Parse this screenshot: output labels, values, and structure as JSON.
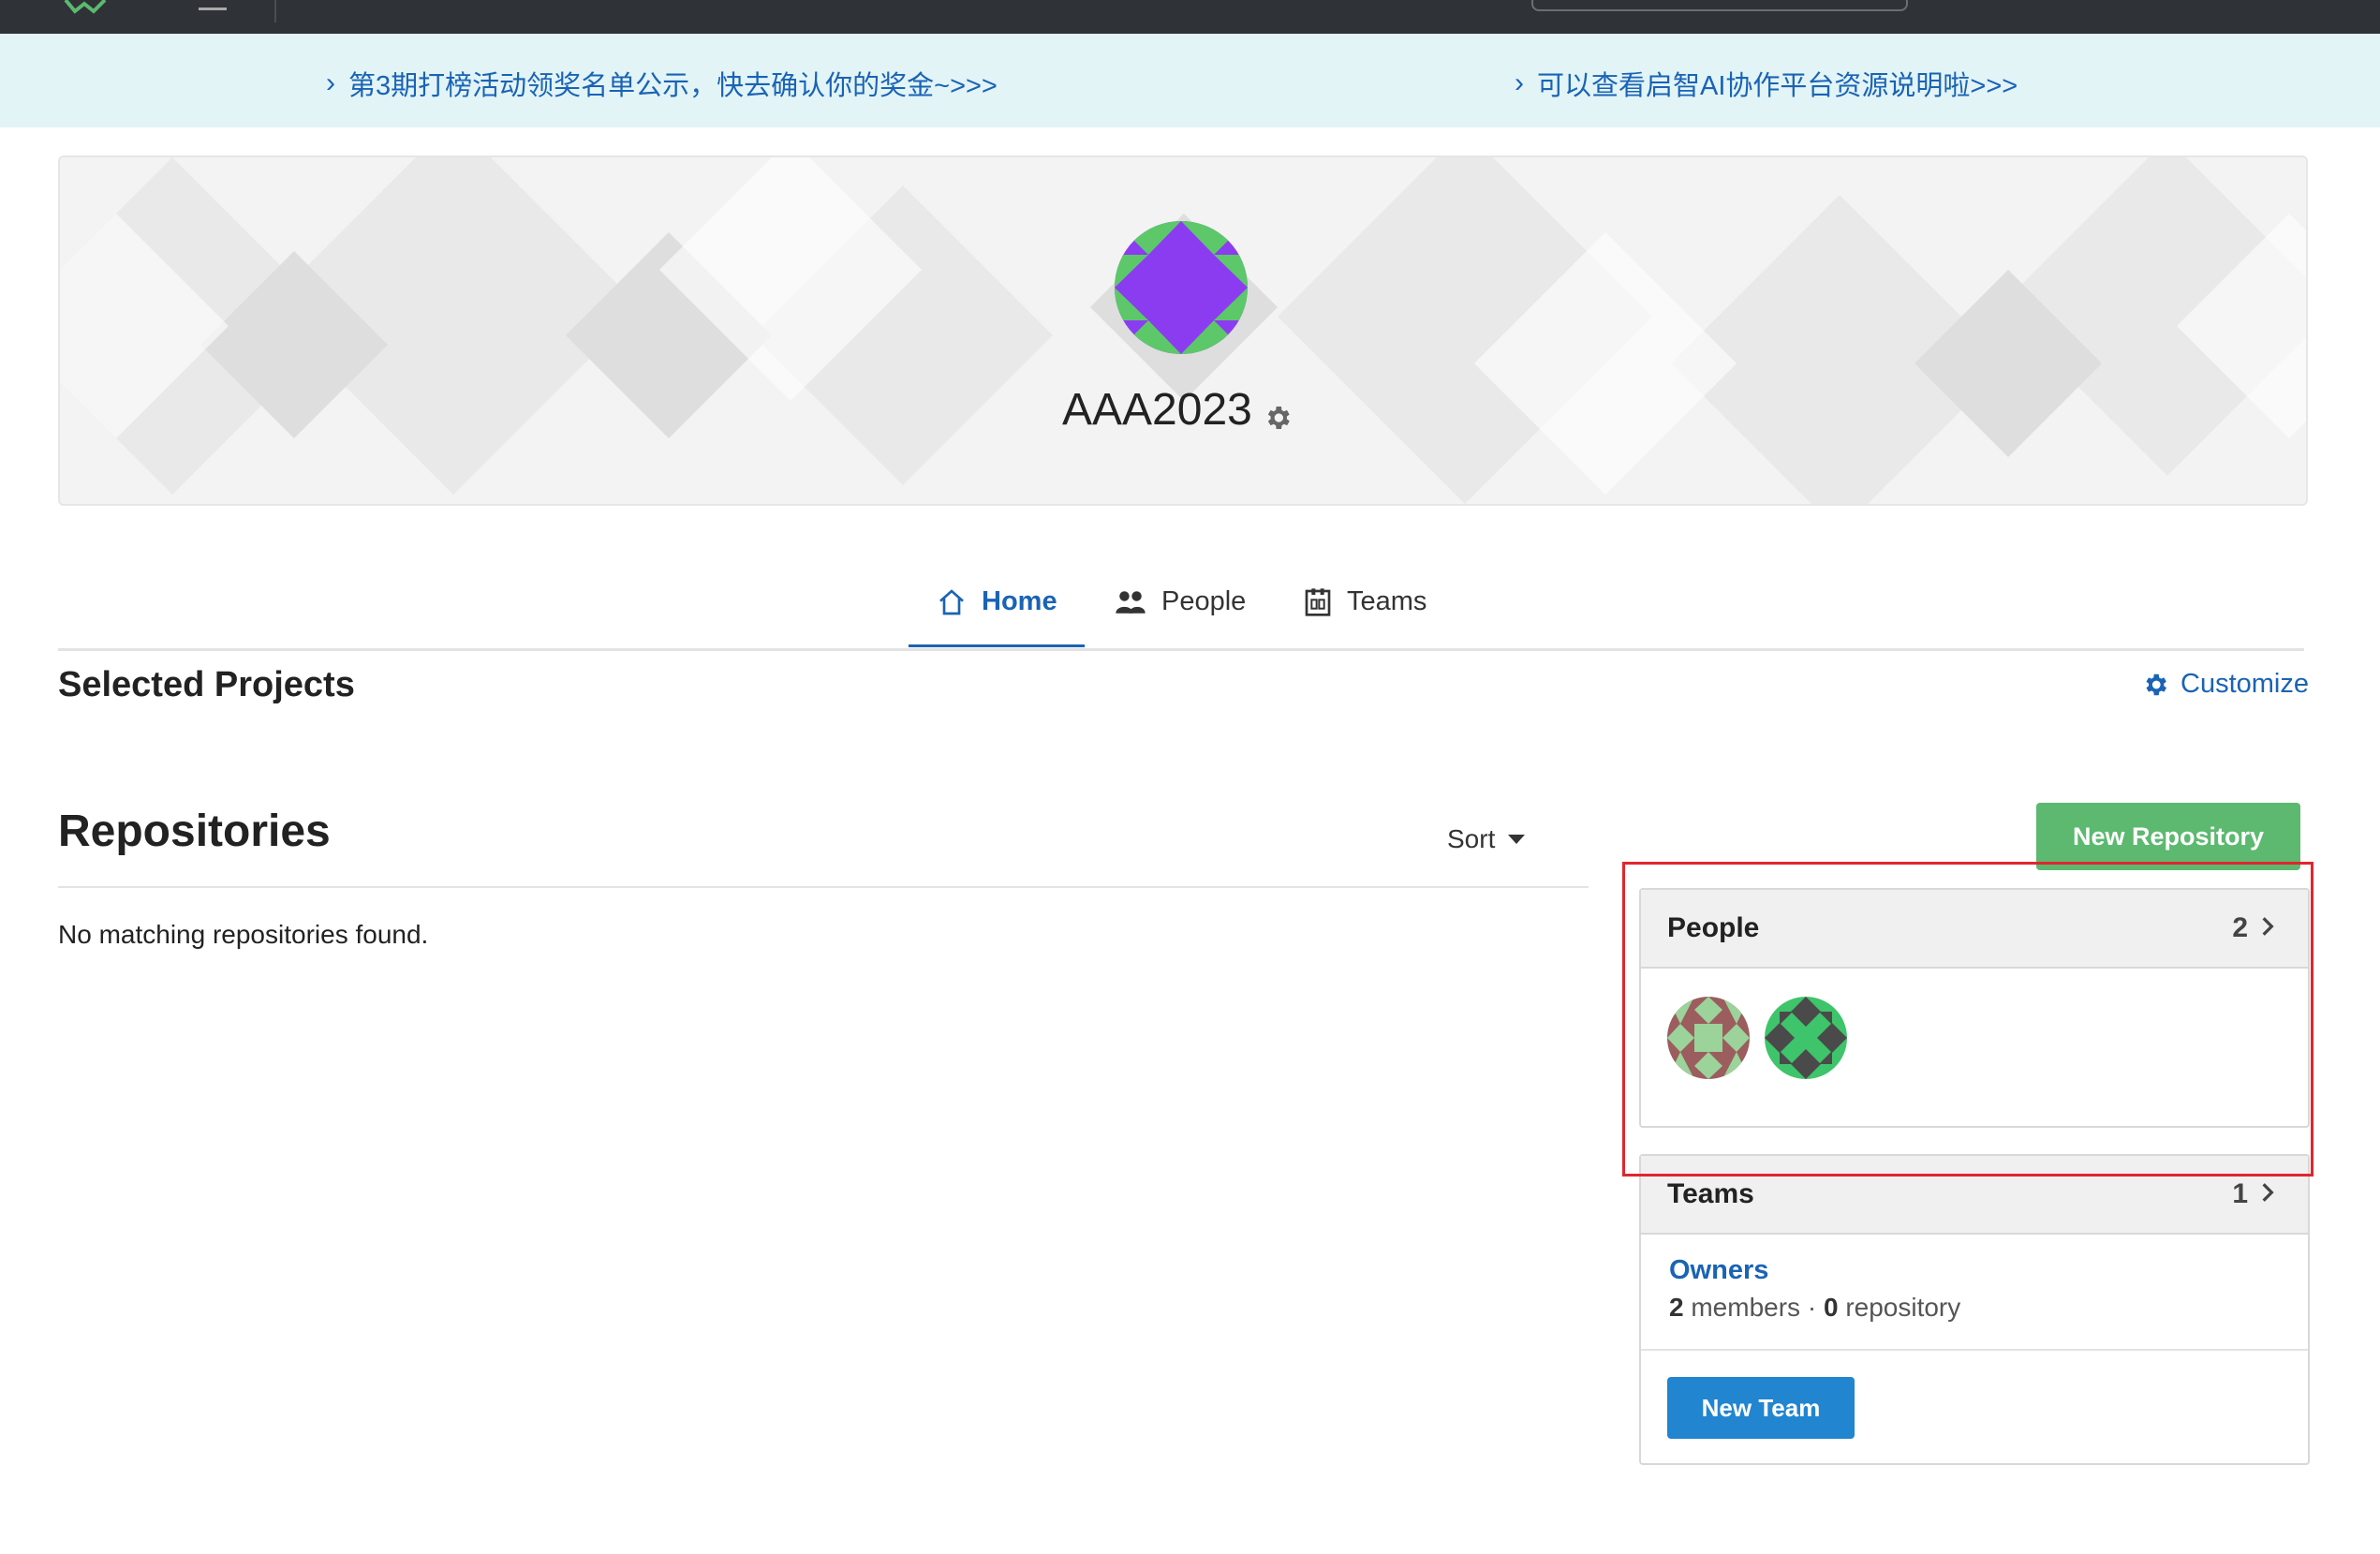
{
  "notice": {
    "items": [
      {
        "label": "第3期打榜活动领奖名单公示，快去确认你的奖金~>>>"
      },
      {
        "label": "可以查看启智AI协作平台资源说明啦>>>"
      }
    ]
  },
  "org": {
    "name": "AAA2023"
  },
  "tabs": [
    {
      "label": "Home",
      "icon": "home-icon"
    },
    {
      "label": "People",
      "icon": "people-icon"
    },
    {
      "label": "Teams",
      "icon": "teams-icon"
    }
  ],
  "selected_projects": {
    "title": "Selected Projects",
    "customize_label": "Customize"
  },
  "repositories": {
    "title": "Repositories",
    "sort_label": "Sort",
    "empty_text": "No matching repositories found.",
    "new_button": "New Repository"
  },
  "sidebar": {
    "people": {
      "title": "People",
      "count": "2",
      "members": [
        "member-avatar-1",
        "member-avatar-2"
      ]
    },
    "teams": {
      "title": "Teams",
      "count": "1",
      "items": [
        {
          "name": "Owners",
          "members": "2",
          "members_label": "members",
          "repos": "0",
          "repos_label": "repository"
        }
      ],
      "new_button": "New Team"
    }
  },
  "colors": {
    "link_blue": "#1a63b5",
    "green_button": "#5cb96f",
    "blue_button": "#2185d0",
    "highlight_red": "#e0262f",
    "notice_bg": "#e2f4f6"
  }
}
